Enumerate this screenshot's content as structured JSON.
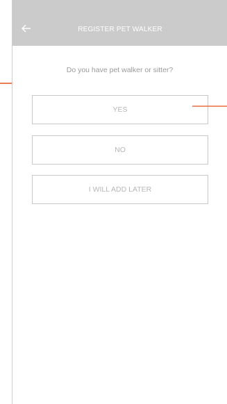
{
  "header": {
    "title": "REGISTER PET WALKER",
    "back_icon": "arrow-left-icon"
  },
  "question": "Do you have pet walker or sitter?",
  "options": [
    {
      "label": "YES"
    },
    {
      "label": "NO"
    },
    {
      "label": "I WILL ADD LATER"
    }
  ],
  "colors": {
    "header_bg": "#cbcbcb",
    "annotation_arrow": "#e0521a",
    "text_muted": "#9a9a9a"
  }
}
